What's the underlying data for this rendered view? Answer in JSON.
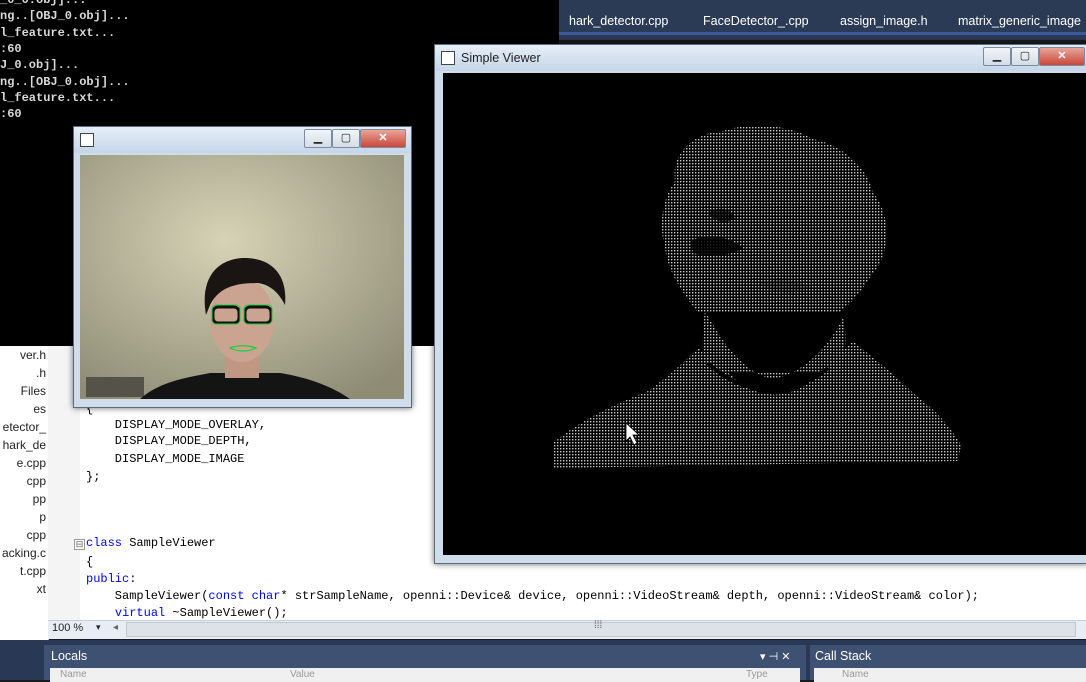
{
  "console": {
    "lines": [
      "_0_0.obj]...",
      "ng..[OBJ_0.obj]...",
      "l_feature.txt...",
      ":60",
      "J_0.obj]...",
      "ng..[OBJ_0.obj]...",
      "l_feature.txt...",
      ":60"
    ]
  },
  "tabs": [
    "hark_detector.cpp",
    "FaceDetector_.cpp",
    "assign_image.h",
    "matrix_generic_image"
  ],
  "solution_explorer": {
    "items": [
      "ver.h",
      ".h",
      "Files",
      "es",
      "etector_",
      "hark_de",
      "e.cpp",
      "cpp",
      "pp",
      "p",
      "cpp",
      "acking.c",
      "t.cpp",
      "xt"
    ]
  },
  "editor": {
    "lines": [
      {
        "text": "{"
      },
      {
        "text": "    DISPLAY_MODE_OVERLAY,"
      },
      {
        "text": "    DISPLAY_MODE_DEPTH,"
      },
      {
        "text": "    DISPLAY_MODE_IMAGE"
      },
      {
        "text": "};"
      },
      {
        "kw": "class",
        "text": " SampleViewer"
      },
      {
        "text": "{"
      },
      {
        "kw": "public",
        "text": ":"
      },
      {
        "text": "    SampleViewer(",
        "kw2": "const",
        "text2": " ",
        "kw3": "char",
        "text3": "* strSampleName, openni::Device& device, openni::VideoStream& depth, openni::VideoStream& color);"
      },
      {
        "pre": "    ",
        "kw": "virtual",
        "text": " ~SampleViewer();"
      }
    ],
    "zoom": "100 %",
    "fold_markers": [
      "⊟"
    ]
  },
  "bottom_panes": {
    "locals": {
      "title": "Locals",
      "columns": [
        "Name",
        "Value",
        "Type"
      ],
      "icons": "▾ ⊣ ✕"
    },
    "call_stack": {
      "title": "Call Stack",
      "columns": [
        "Name"
      ]
    }
  },
  "windows": {
    "simple_viewer": {
      "title": "Simple Viewer",
      "controls": [
        "▁",
        "▢",
        "✕"
      ]
    },
    "camera": {
      "title": "",
      "controls": [
        "▁",
        "▢",
        "✕"
      ]
    }
  },
  "colors": {
    "ide_chrome": "#293955",
    "keyword": "#0000ff",
    "landmark": "#19d13a",
    "point_cloud": "#bfbfbf"
  }
}
